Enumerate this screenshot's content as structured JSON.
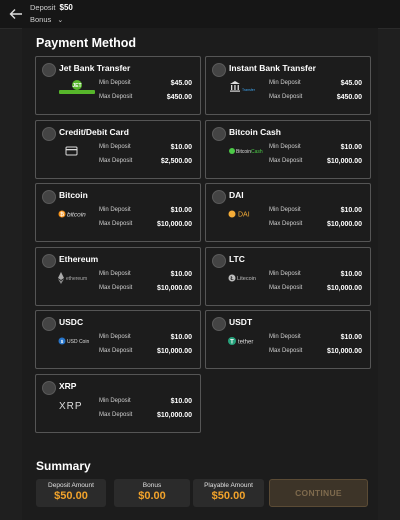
{
  "header": {
    "deposit_label": "Deposit",
    "deposit_amount": "$50",
    "bonus_label": "Bonus",
    "bonus_chevron": "⌄"
  },
  "payment": {
    "title": "Payment Method",
    "min_label": "Min Deposit",
    "max_label": "Max Deposit",
    "methods": [
      {
        "name": "Jet Bank Transfer",
        "logo_text": "JET BANK TRANSFER",
        "min": "$45.00",
        "max": "$450.00"
      },
      {
        "name": "Instant Bank Transfer",
        "logo_text": "Instant Transfer",
        "min": "$45.00",
        "max": "$450.00"
      },
      {
        "name": "Credit/Debit Card",
        "logo_text": "",
        "min": "$10.00",
        "max": "$2,500.00"
      },
      {
        "name": "Bitcoin Cash",
        "logo_text": "BitcoinCash",
        "min": "$10.00",
        "max": "$10,000.00"
      },
      {
        "name": "Bitcoin",
        "logo_text": "bitcoin",
        "min": "$10.00",
        "max": "$10,000.00"
      },
      {
        "name": "DAI",
        "logo_text": "DAI",
        "min": "$10.00",
        "max": "$10,000.00"
      },
      {
        "name": "Ethereum",
        "logo_text": "ethereum",
        "min": "$10.00",
        "max": "$10,000.00"
      },
      {
        "name": "LTC",
        "logo_text": "Litecoin",
        "min": "$10.00",
        "max": "$10,000.00"
      },
      {
        "name": "USDC",
        "logo_text": "USD Coin",
        "min": "$10.00",
        "max": "$10,000.00"
      },
      {
        "name": "USDT",
        "logo_text": "tether",
        "min": "$10.00",
        "max": "$10,000.00"
      },
      {
        "name": "XRP",
        "logo_text": "XRP",
        "min": "$10.00",
        "max": "$10,000.00"
      }
    ]
  },
  "summary": {
    "title": "Summary",
    "deposit_amount_label": "Deposit Amount",
    "deposit_amount_value": "$50.00",
    "bonus_label": "Bonus",
    "bonus_value": "$0.00",
    "playable_label": "Playable Amount",
    "playable_value": "$50.00",
    "continue_label": "CONTINUE"
  },
  "colors": {
    "accent": "#f2a32b",
    "background": "#1c1c1c",
    "continue_disabled": "#3d3428"
  }
}
